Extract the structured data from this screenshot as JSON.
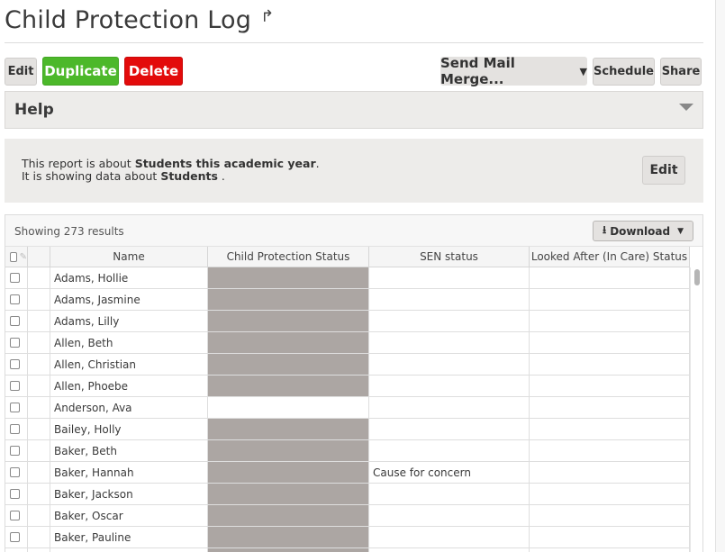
{
  "page": {
    "title": "Child Protection Log",
    "share_icon": "share-arrow-icon"
  },
  "toolbar": {
    "edit_label": "Edit",
    "duplicate_label": "Duplicate",
    "delete_label": "Delete",
    "mail_merge_label": "Send Mail Merge...",
    "schedule_label": "Schedule",
    "share_label": "Share"
  },
  "help": {
    "title": "Help"
  },
  "info": {
    "line1_prefix": "This report is about",
    "line1_bold": "Students this academic year",
    "line1_suffix": ".",
    "line2_prefix": "It is showing data about",
    "line2_bold": "Students",
    "line2_suffix": " .",
    "edit_label": "Edit"
  },
  "grid": {
    "showing_text": "Showing 273 results",
    "download_label": "Download",
    "columns": [
      "Name",
      "Child Protection Status",
      "SEN status",
      "Looked After (In Care) Status"
    ],
    "rows": [
      {
        "name": "Adams, Hollie",
        "cp": "",
        "cp_filled": true,
        "sen": "",
        "lac": ""
      },
      {
        "name": "Adams, Jasmine",
        "cp": "",
        "cp_filled": true,
        "sen": "",
        "lac": ""
      },
      {
        "name": "Adams, Lilly",
        "cp": "",
        "cp_filled": true,
        "sen": "",
        "lac": ""
      },
      {
        "name": "Allen, Beth",
        "cp": "",
        "cp_filled": true,
        "sen": "",
        "lac": ""
      },
      {
        "name": "Allen, Christian",
        "cp": "",
        "cp_filled": true,
        "sen": "",
        "lac": ""
      },
      {
        "name": "Allen, Phoebe",
        "cp": "",
        "cp_filled": true,
        "sen": "",
        "lac": ""
      },
      {
        "name": "Anderson, Ava",
        "cp": "",
        "cp_filled": false,
        "sen": "",
        "lac": ""
      },
      {
        "name": "Bailey, Holly",
        "cp": "",
        "cp_filled": true,
        "sen": "",
        "lac": ""
      },
      {
        "name": "Baker, Beth",
        "cp": "",
        "cp_filled": true,
        "sen": "",
        "lac": ""
      },
      {
        "name": "Baker, Hannah",
        "cp": "",
        "cp_filled": true,
        "sen": "Cause for concern",
        "lac": ""
      },
      {
        "name": "Baker, Jackson",
        "cp": "",
        "cp_filled": true,
        "sen": "",
        "lac": ""
      },
      {
        "name": "Baker, Oscar",
        "cp": "",
        "cp_filled": true,
        "sen": "",
        "lac": ""
      },
      {
        "name": "Baker, Pauline",
        "cp": "",
        "cp_filled": true,
        "sen": "",
        "lac": ""
      },
      {
        "name": "",
        "cp": "",
        "cp_filled": true,
        "sen": "",
        "lac": ""
      }
    ]
  },
  "colors": {
    "green": "#4cb82a",
    "red": "#e30b0b",
    "redacted_gray": "#aca6a3",
    "panel_gray": "#edecea"
  }
}
